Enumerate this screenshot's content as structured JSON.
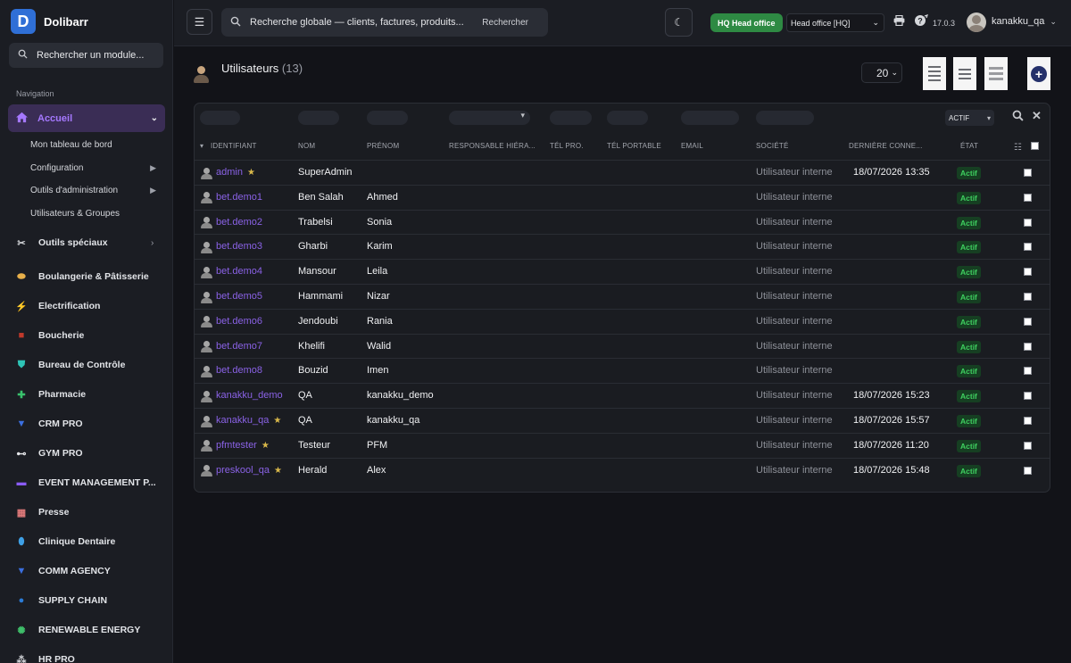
{
  "brand": {
    "name": "Dolibarr",
    "logo_letter": "D"
  },
  "sidebar": {
    "search_placeholder": "Rechercher un module...",
    "nav_heading": "Navigation",
    "home": {
      "label": "Accueil",
      "icon": "home-icon",
      "color": "#a578ff"
    },
    "subitems": [
      {
        "label": "Mon tableau de bord",
        "has_arrow": false
      },
      {
        "label": "Configuration",
        "has_arrow": true
      },
      {
        "label": "Outils d'administration",
        "has_arrow": true
      },
      {
        "label": "Utilisateurs & Groupes",
        "has_arrow": false
      }
    ],
    "modules": [
      {
        "label": "Outils spéciaux",
        "icon": "tools-icon",
        "color": "#d0d2d6",
        "has_arrow": true
      },
      {
        "label": "Boulangerie & Pâtisserie",
        "icon": "bread-icon",
        "color": "#e8b04a"
      },
      {
        "label": "Electrification",
        "icon": "lightning-icon",
        "color": "#f3c623"
      },
      {
        "label": "Boucherie",
        "icon": "meat-icon",
        "color": "#c0392b"
      },
      {
        "label": "Bureau de Contrôle",
        "icon": "shield-icon",
        "color": "#2ec4b6"
      },
      {
        "label": "Pharmacie",
        "icon": "plus-cross-icon",
        "color": "#39c16c"
      },
      {
        "label": "CRM PRO",
        "icon": "filter-icon",
        "color": "#3b6fe0"
      },
      {
        "label": "GYM PRO",
        "icon": "dumbbell-icon",
        "color": "#e6e7ea"
      },
      {
        "label": "EVENT MANAGEMENT P...",
        "icon": "event-icon",
        "color": "#8b5cf6"
      },
      {
        "label": "Presse",
        "icon": "newspaper-icon",
        "color": "#e07a7a"
      },
      {
        "label": "Clinique Dentaire",
        "icon": "tooth-icon",
        "color": "#3ea0e6"
      },
      {
        "label": "COMM AGENCY",
        "icon": "funnel-icon",
        "color": "#3b6fe0"
      },
      {
        "label": "SUPPLY CHAIN",
        "icon": "boxes-icon",
        "color": "#2b7bd6"
      },
      {
        "label": "RENEWABLE ENERGY",
        "icon": "sun-icon",
        "color": "#3fbf6a"
      },
      {
        "label": "HR PRO",
        "icon": "org-icon",
        "color": "#d0d2d6"
      }
    ]
  },
  "topbar": {
    "search_placeholder": "Recherche globale — clients, factures, produits...",
    "search_button": "Rechercher",
    "hq_badge": "HQ Head office",
    "entity_select": "Head office [HQ]",
    "version": "17.0.3",
    "username": "kanakku_qa"
  },
  "page": {
    "title": "Utilisateurs",
    "count": "(13)",
    "per_page": "20"
  },
  "table": {
    "filter_status": "ACTIF",
    "columns": [
      "IDENTIFIANT",
      "NOM",
      "PRÉNOM",
      "RESPONSABLE HIÉRA...",
      "TÉL PRO.",
      "TÉL PORTABLE",
      "EMAIL",
      "SOCIÉTÉ",
      "DERNIÈRE CONNE...",
      "ÉTAT"
    ],
    "rows": [
      {
        "login": "admin",
        "admin": true,
        "nom": "SuperAdmin",
        "prenom": "",
        "societe": "Utilisateur interne",
        "last": "18/07/2026 13:35",
        "etat": "Actif"
      },
      {
        "login": "bet.demo1",
        "admin": false,
        "nom": "Ben Salah",
        "prenom": "Ahmed",
        "societe": "Utilisateur interne",
        "last": "",
        "etat": "Actif"
      },
      {
        "login": "bet.demo2",
        "admin": false,
        "nom": "Trabelsi",
        "prenom": "Sonia",
        "societe": "Utilisateur interne",
        "last": "",
        "etat": "Actif"
      },
      {
        "login": "bet.demo3",
        "admin": false,
        "nom": "Gharbi",
        "prenom": "Karim",
        "societe": "Utilisateur interne",
        "last": "",
        "etat": "Actif"
      },
      {
        "login": "bet.demo4",
        "admin": false,
        "nom": "Mansour",
        "prenom": "Leila",
        "societe": "Utilisateur interne",
        "last": "",
        "etat": "Actif"
      },
      {
        "login": "bet.demo5",
        "admin": false,
        "nom": "Hammami",
        "prenom": "Nizar",
        "societe": "Utilisateur interne",
        "last": "",
        "etat": "Actif"
      },
      {
        "login": "bet.demo6",
        "admin": false,
        "nom": "Jendoubi",
        "prenom": "Rania",
        "societe": "Utilisateur interne",
        "last": "",
        "etat": "Actif"
      },
      {
        "login": "bet.demo7",
        "admin": false,
        "nom": "Khelifi",
        "prenom": "Walid",
        "societe": "Utilisateur interne",
        "last": "",
        "etat": "Actif"
      },
      {
        "login": "bet.demo8",
        "admin": false,
        "nom": "Bouzid",
        "prenom": "Imen",
        "societe": "Utilisateur interne",
        "last": "",
        "etat": "Actif"
      },
      {
        "login": "kanakku_demo",
        "admin": false,
        "nom": "QA",
        "prenom": "kanakku_demo",
        "societe": "Utilisateur interne",
        "last": "18/07/2026 15:23",
        "etat": "Actif"
      },
      {
        "login": "kanakku_qa",
        "admin": true,
        "nom": "QA",
        "prenom": "kanakku_qa",
        "societe": "Utilisateur interne",
        "last": "18/07/2026 15:57",
        "etat": "Actif"
      },
      {
        "login": "pfmtester",
        "admin": true,
        "nom": "Testeur",
        "prenom": "PFM",
        "societe": "Utilisateur interne",
        "last": "18/07/2026 11:20",
        "etat": "Actif"
      },
      {
        "login": "preskool_qa",
        "admin": true,
        "nom": "Herald",
        "prenom": "Alex",
        "societe": "Utilisateur interne",
        "last": "18/07/2026 15:48",
        "etat": "Actif"
      }
    ]
  },
  "colors": {
    "accent": "#8a62e6",
    "status_active": "#3fd160",
    "hq_green": "#2e8a43"
  }
}
